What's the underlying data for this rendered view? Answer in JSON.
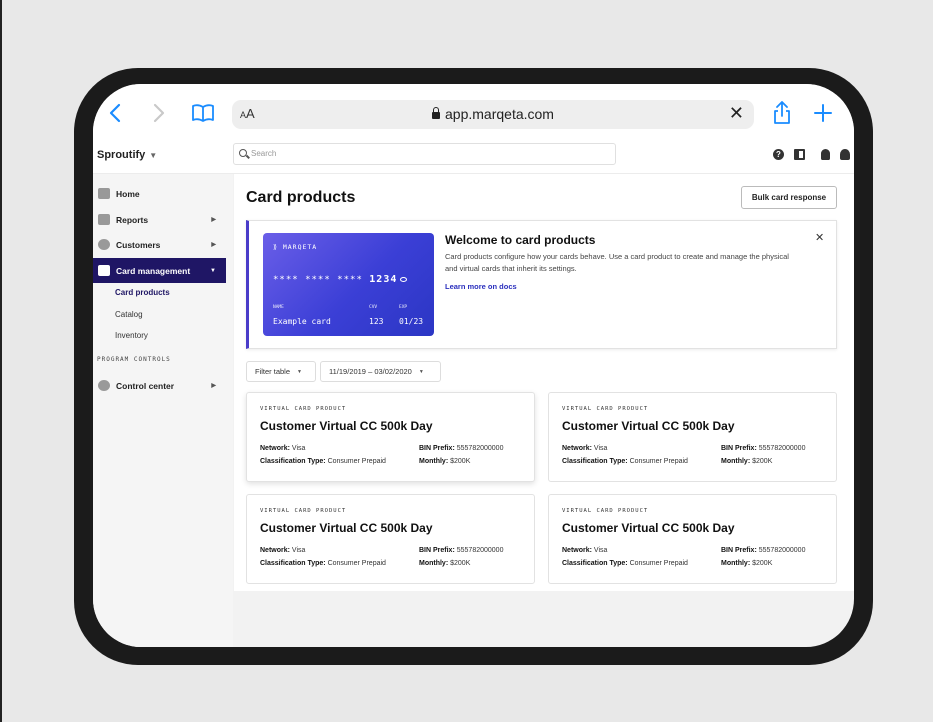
{
  "browser": {
    "text_size_label": "AA",
    "url": "app.marqeta.com"
  },
  "header": {
    "org_name": "Sproutify",
    "search_placeholder": "Search"
  },
  "sidebar": {
    "items": [
      {
        "label": "Home"
      },
      {
        "label": "Reports"
      },
      {
        "label": "Customers"
      },
      {
        "label": "Card management"
      }
    ],
    "sub_items": [
      {
        "label": "Card products"
      },
      {
        "label": "Catalog"
      },
      {
        "label": "Inventory"
      }
    ],
    "section_label": "PROGRAM CONTROLS",
    "control_center": "Control center"
  },
  "main": {
    "title": "Card products",
    "bulk_button": "Bulk card response",
    "welcome": {
      "title": "Welcome to card products",
      "description": "Card products configure how your cards behave. Use a card product to create and manage the physical and virtual cards that inherit its settings.",
      "link": "Learn more on docs",
      "card": {
        "brand": "MARQETA",
        "masked": "**** **** ****",
        "last4": "1234",
        "name_label": "NAME",
        "name_value": "Example card",
        "cvv_label": "CVV",
        "cvv_value": "123",
        "exp_label": "EXP",
        "exp_value": "01/23"
      }
    },
    "filters": {
      "filter_label": "Filter table",
      "date_range": "11/19/2019 – 03/02/2020"
    },
    "products": [
      {
        "kind": "VIRTUAL CARD PRODUCT",
        "name": "Customer Virtual CC 500k Day",
        "network_label": "Network:",
        "network": "Visa",
        "bin_label": "BIN Prefix:",
        "bin": "555782000000",
        "class_label": "Classification Type:",
        "classification": "Consumer Prepaid",
        "monthly_label": "Monthly:",
        "monthly": "$200K"
      },
      {
        "kind": "VIRTUAL CARD PRODUCT",
        "name": "Customer Virtual CC 500k Day",
        "network_label": "Network:",
        "network": "Visa",
        "bin_label": "BIN Prefix:",
        "bin": "555782000000",
        "class_label": "Classification Type:",
        "classification": "Consumer Prepaid",
        "monthly_label": "Monthly:",
        "monthly": "$200K"
      },
      {
        "kind": "VIRTUAL CARD PRODUCT",
        "name": "Customer Virtual CC 500k Day",
        "network_label": "Network:",
        "network": "Visa",
        "bin_label": "BIN Prefix:",
        "bin": "555782000000",
        "class_label": "Classification Type:",
        "classification": "Consumer Prepaid",
        "monthly_label": "Monthly:",
        "monthly": "$200K"
      },
      {
        "kind": "VIRTUAL CARD PRODUCT",
        "name": "Customer Virtual CC 500k Day",
        "network_label": "Network:",
        "network": "Visa",
        "bin_label": "BIN Prefix:",
        "bin": "555782000000",
        "class_label": "Classification Type:",
        "classification": "Consumer Prepaid",
        "monthly_label": "Monthly:",
        "monthly": "$200K"
      }
    ]
  },
  "colors": {
    "accent": "#1f1665",
    "link": "#2a2fbd",
    "browser_blue": "#1a8cff"
  }
}
